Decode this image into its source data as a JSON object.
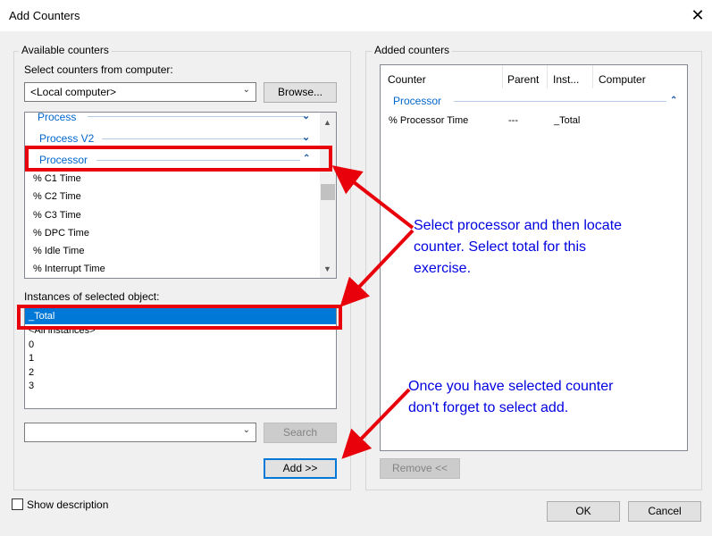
{
  "window": {
    "title": "Add Counters",
    "close_symbol": "✕"
  },
  "available": {
    "group_label": "Available counters",
    "select_label": "Select counters from computer:",
    "computer_value": "<Local computer>",
    "browse_label": "Browse...",
    "objects": [
      {
        "label": "Process",
        "state": "collapsed"
      },
      {
        "label": "Process V2",
        "state": "collapsed"
      },
      {
        "label": "Processor",
        "state": "expanded"
      }
    ],
    "counters": [
      "% C1 Time",
      "% C2 Time",
      "% C3 Time",
      "% DPC Time",
      "% Idle Time",
      "% Interrupt Time"
    ],
    "instances_label": "Instances of selected object:",
    "instances": [
      "_Total",
      "<All instances>",
      "0",
      "1",
      "2",
      "3"
    ],
    "search_value": "",
    "search_label": "Search",
    "add_label": "Add >>"
  },
  "added": {
    "group_label": "Added counters",
    "columns": [
      "Counter",
      "Parent",
      "Inst...",
      "Computer"
    ],
    "group_row": "Processor",
    "rows": [
      {
        "counter": "% Processor Time",
        "parent": "---",
        "instance": "_Total",
        "computer": ""
      }
    ],
    "remove_label": "Remove <<"
  },
  "footer": {
    "show_description": "Show description",
    "ok_label": "OK",
    "cancel_label": "Cancel"
  },
  "annotations": {
    "note1": [
      "Select processor and then locate",
      "counter. Select total for this",
      "exercise."
    ],
    "note2": [
      "Once you have selected counter",
      "don't forget to select add."
    ]
  },
  "colors": {
    "annotation": "#0000e0",
    "highlight": "#e8000b",
    "selection": "#0078d7",
    "category": "#0066cc"
  }
}
